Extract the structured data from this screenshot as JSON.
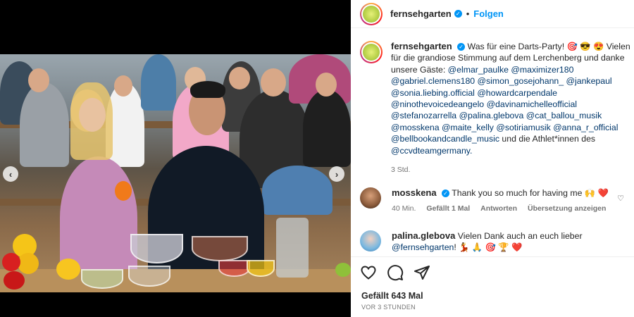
{
  "post": {
    "account": "fernsehgarten",
    "follow_label": "Folgen",
    "separator": "•",
    "caption_lines": [
      {
        "pre": "Was für eine Darts-Party! 🎯 😎 😍 Vielen D"
      },
      {
        "pre": "für die grandiose Stimmung auf dem Lerchenberg und danke"
      },
      {
        "pre": "unsere Gäste: ",
        "mentions": [
          "@elmar_paulke",
          "@maximizer180"
        ]
      },
      {
        "mentions": [
          "@gabriel.clemens180",
          "@simon_gosejohann_",
          "@jankepaul"
        ]
      },
      {
        "mentions": [
          "@sonia.liebing.official",
          "@howardcarpendale"
        ]
      },
      {
        "mentions": [
          "@ninothevoicedeangelo",
          "@davinamichelleofficial"
        ]
      },
      {
        "mentions": [
          "@stefanozarrella",
          "@palina.glebova",
          "@cat_ballou_musik"
        ]
      },
      {
        "mentions": [
          "@mosskena",
          "@maite_kelly",
          "@sotiriamusik",
          "@anna_r_official"
        ]
      },
      {
        "mentions": [
          "@bellbookandcandle_music"
        ],
        "post": " und die Athlet*innen des"
      },
      {
        "mentions": [
          "@ccvdteamgermany."
        ]
      }
    ],
    "age": "3 Std.",
    "likes_label": "Gefällt 643 Mal",
    "timestamp": "VOR 3 STUNDEN"
  },
  "comments": [
    {
      "user": "mosskena",
      "text": "Thank you so much for having me 🙌 ❤️",
      "meta": {
        "age": "40 Min.",
        "likes": "Gefällt 1 Mal",
        "reply": "Antworten",
        "translate": "Übersetzung anzeigen"
      }
    },
    {
      "user": "palina.glebova",
      "text": "Vielen Dank auch an euch lieber",
      "mention": "@fernsehgarten",
      "text_end": "! 💃 🙏 🎯 🏆 ❤️"
    }
  ],
  "icons": {
    "like": "heart-icon",
    "comment": "comment-icon",
    "share": "share-icon",
    "prev": "chevron-left-icon",
    "next": "chevron-right-icon",
    "verified": "verified-badge-icon",
    "comment_like": "heart-outline-icon"
  },
  "colors": {
    "accent": "#0095f6",
    "mention": "#00376b",
    "muted": "#737373",
    "heart_red": "#ed4956"
  }
}
